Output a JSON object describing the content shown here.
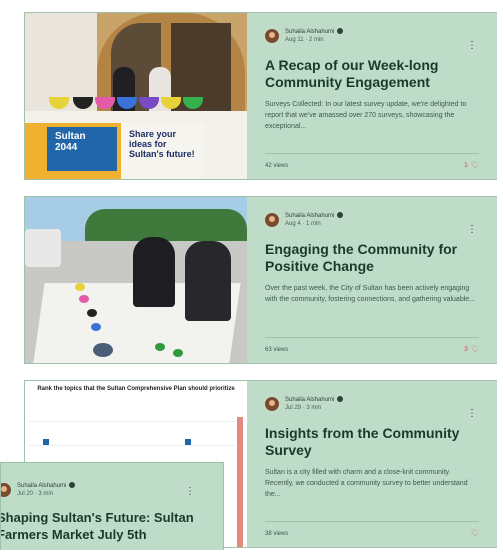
{
  "posts": [
    {
      "author": "Suhaila Alshahumi",
      "date": "Aug 11",
      "read_time": "2 min",
      "title": "A Recap of our Week-long Community Engagement",
      "excerpt": "Surveys Collected: In our latest survey update, we're delighted to report that we've amassed over 270 surveys, showcasing the exceptional...",
      "views": "42 views",
      "likes": "1",
      "image_text": {
        "brand_line1": "Sultan",
        "brand_line2": "2044",
        "sign": "Share your ideas for Sultan's future!"
      }
    },
    {
      "author": "Suhaila Alshahumi",
      "date": "Aug 4",
      "read_time": "1 min",
      "title": "Engaging the Community for Positive Change",
      "excerpt": "Over the past week, the City of Sultan has been actively engaging with the community, fostering connections, and gathering valuable...",
      "views": "63 views",
      "likes": "3"
    },
    {
      "author": "Suhaila Alshahumi",
      "date": "Jul 29",
      "read_time": "3 min",
      "title": "Insights from the Community Survey",
      "excerpt": "Sultan is a city filled with charm and a close-knit community. Recently, we conducted a community survey to better understand the...",
      "views": "38 views",
      "likes": "",
      "image_text": {
        "chart_title": "Rank the topics that the Sultan Comprehensive Plan should prioritize"
      }
    },
    {
      "author": "Suhaila Alshahumi",
      "date": "Jul 20",
      "read_time": "3 min",
      "title": "Shaping Sultan's Future: Sultan Farmers Market July 5th"
    }
  ],
  "icons": {
    "verified": "verified-badge-icon",
    "more": "more-options-icon",
    "like": "heart-icon"
  },
  "colors": {
    "card_bg": "#bfdcc9",
    "title": "#1c3a2b",
    "heart": "#d7555a"
  }
}
